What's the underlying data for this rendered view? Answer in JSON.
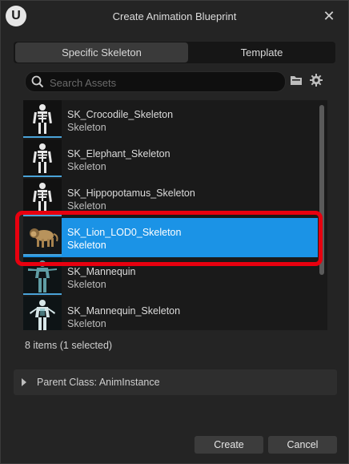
{
  "window": {
    "title": "Create Animation Blueprint"
  },
  "tabs": [
    {
      "label": "Specific Skeleton",
      "active": true
    },
    {
      "label": "Template",
      "active": false
    }
  ],
  "search": {
    "placeholder": "Search Assets",
    "value": ""
  },
  "assets": [
    {
      "name": "SK_Crocodile_Skeleton",
      "type": "Skeleton",
      "thumbnail": "skeleton-icon",
      "selected": false
    },
    {
      "name": "SK_Elephant_Skeleton",
      "type": "Skeleton",
      "thumbnail": "skeleton-icon",
      "selected": false
    },
    {
      "name": "SK_Hippopotamus_Skeleton",
      "type": "Skeleton",
      "thumbnail": "skeleton-icon",
      "selected": false
    },
    {
      "name": "SK_Lion_LOD0_Skeleton",
      "type": "Skeleton",
      "thumbnail": "lion-model",
      "selected": true
    },
    {
      "name": "SK_Mannequin",
      "type": "Skeleton",
      "thumbnail": "mannequin-model",
      "selected": false
    },
    {
      "name": "SK_Mannequin_Skeleton",
      "type": "Skeleton",
      "thumbnail": "mannequin-model",
      "selected": false
    }
  ],
  "status": "8 items (1 selected)",
  "parent_class": {
    "label": "Parent Class: AnimInstance"
  },
  "buttons": {
    "create": "Create",
    "cancel": "Cancel"
  },
  "colors": {
    "selection": "#1b93e6",
    "highlight_outline": "#e8000f",
    "accent_bar": "#4aa3d8"
  }
}
